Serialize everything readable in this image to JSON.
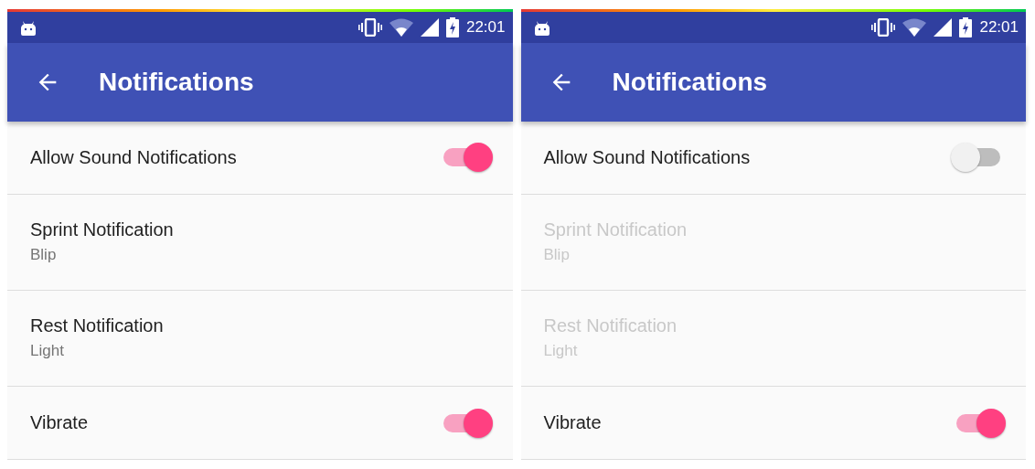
{
  "screens": [
    {
      "status_bar": {
        "time": "22:01"
      },
      "app_bar": {
        "title": "Notifications"
      },
      "settings": [
        {
          "kind": "switch",
          "title": "Allow Sound Notifications",
          "on": true,
          "disabled": false
        },
        {
          "kind": "detail",
          "title": "Sprint Notification",
          "summary": "Blip",
          "disabled": false
        },
        {
          "kind": "detail",
          "title": "Rest Notification",
          "summary": "Light",
          "disabled": false
        },
        {
          "kind": "switch",
          "title": "Vibrate",
          "on": true,
          "disabled": false
        }
      ]
    },
    {
      "status_bar": {
        "time": "22:01"
      },
      "app_bar": {
        "title": "Notifications"
      },
      "settings": [
        {
          "kind": "switch",
          "title": "Allow Sound Notifications",
          "on": false,
          "disabled": false
        },
        {
          "kind": "detail",
          "title": "Sprint Notification",
          "summary": "Blip",
          "disabled": true
        },
        {
          "kind": "detail",
          "title": "Rest Notification",
          "summary": "Light",
          "disabled": true
        },
        {
          "kind": "switch",
          "title": "Vibrate",
          "on": true,
          "disabled": false
        }
      ]
    }
  ]
}
